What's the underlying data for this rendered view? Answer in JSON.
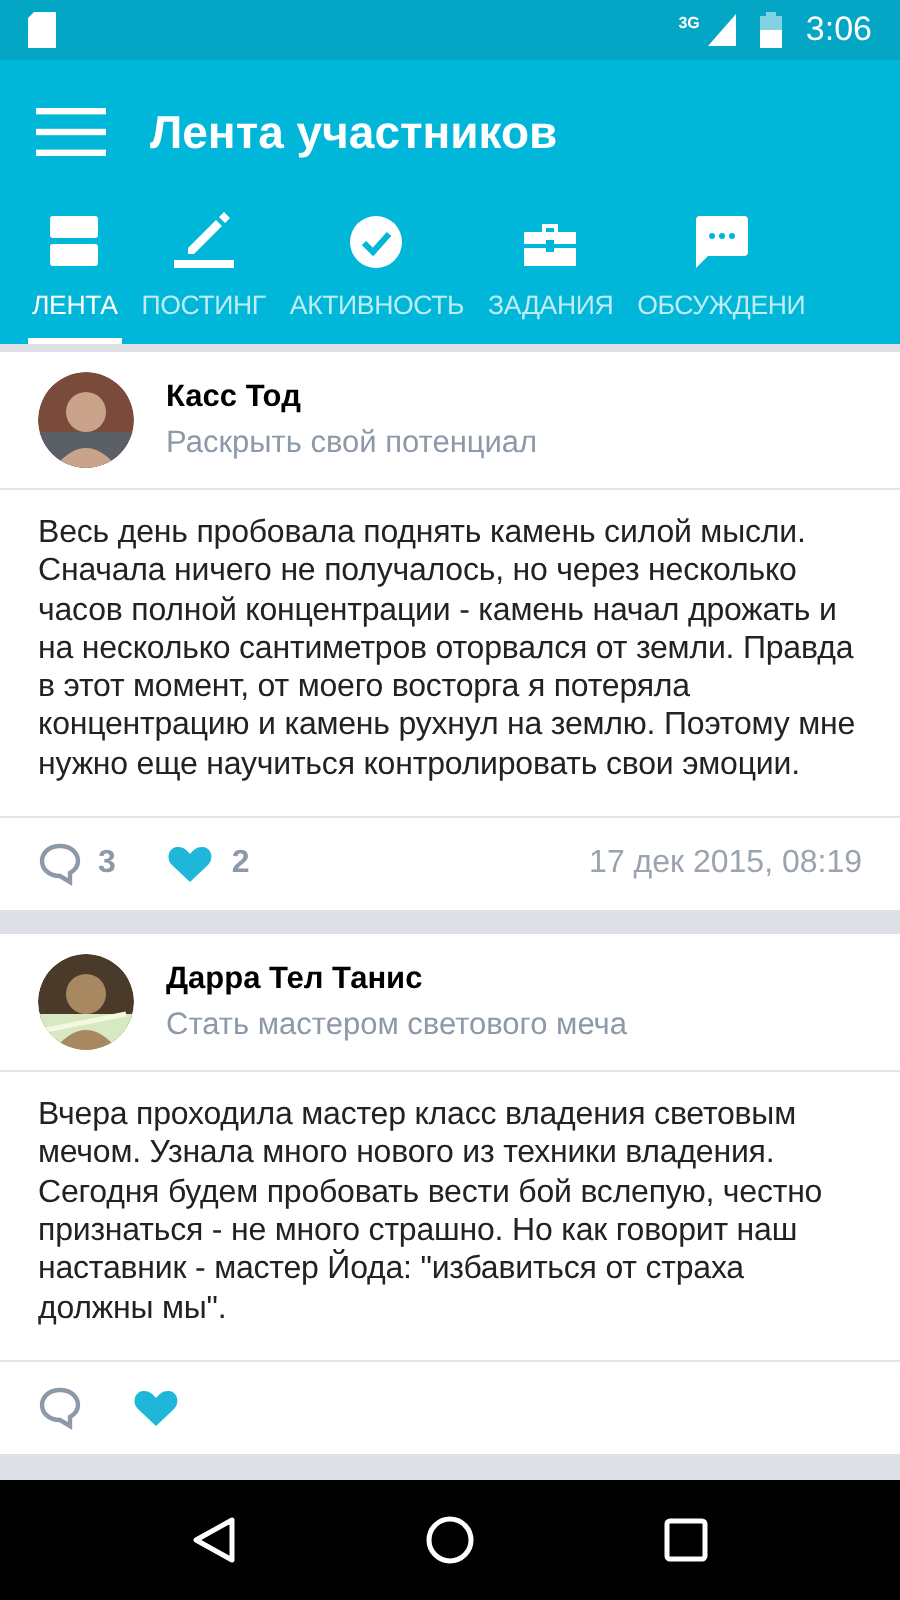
{
  "status_bar": {
    "network": "3G",
    "time": "3:06"
  },
  "app_bar": {
    "title": "Лента участников"
  },
  "tabs": [
    {
      "label": "ЛЕНТА",
      "selected": true
    },
    {
      "label": "ПОСТИНГ",
      "selected": false
    },
    {
      "label": "АКТИВНОСТЬ",
      "selected": false
    },
    {
      "label": "ЗАДАНИЯ",
      "selected": false
    },
    {
      "label": "ОБСУЖДЕНИ",
      "selected": false
    }
  ],
  "posts": [
    {
      "author": "Касс Тод",
      "subtitle": "Раскрыть свой потенциал",
      "text": "Весь день пробовала поднять камень силой мысли. Сначала ничего не получалось, но через несколько часов полной концентрации - камень начал дрожать и на несколько сантиметров оторвался от земли. Правда в этот момент, от моего восторга я потеряла концентрацию и камень рухнул на землю. Поэтому мне нужно еще научиться контролировать свои эмоции.",
      "comments": "3",
      "likes": "2",
      "liked": true,
      "date": "17 дек 2015, 08:19"
    },
    {
      "author": "Дарра Тел Танис",
      "subtitle": "Стать мастером светового меча",
      "text": "Вчера проходила мастер класс владения световым мечом. Узнала много нового из техники владения. Сегодня будем пробовать вести бой вслепую, честно признаться - не много страшно. Но как говорит наш наставник - мастер Йода: \"избавиться от страха должны мы\".",
      "liked": true
    }
  ]
}
